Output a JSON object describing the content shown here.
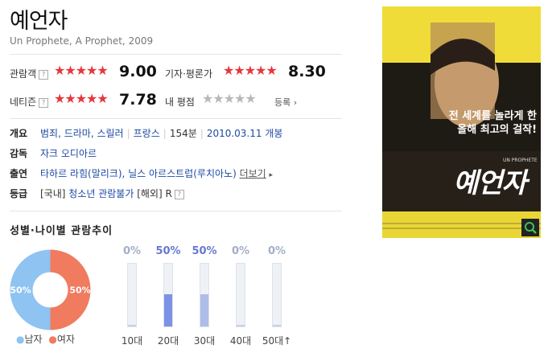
{
  "movie": {
    "title": "예언자",
    "subtitle": "Un Prophete, A Prophet, 2009"
  },
  "ratings": {
    "audience": {
      "label": "관람객",
      "help": "?",
      "stars": "★★★★★",
      "score": "9.00",
      "value": 9.0
    },
    "critics": {
      "label": "기자·평론가",
      "stars": "★★★★★",
      "score": "8.30",
      "value": 8.3
    },
    "netizen": {
      "label": "네티즌",
      "help": "?",
      "stars": "★★★★★",
      "score": "7.78",
      "value": 7.78
    },
    "my": {
      "label": "내 평점",
      "stars": "★★★★★",
      "register": "등록",
      "arrow": "›"
    }
  },
  "info": {
    "overview_key": "개요",
    "genres": "범죄, 드라마, 스릴러",
    "country": "프랑스",
    "runtime": "154분",
    "release": "2010.03.11 개봉",
    "director_key": "감독",
    "director": "자크 오디아르",
    "cast_key": "출연",
    "cast": "타하르 라힘(말리크), 닐스 아르스트럽(루치아노)",
    "more": "더보기",
    "more_arrow": "▸",
    "grade_key": "등급",
    "grade_prefix": "[국내]",
    "grade_domestic": "청소년 관람불가",
    "grade_foreign_prefix": "[해외]",
    "grade_foreign": "R",
    "grade_help": "?"
  },
  "chart_section": {
    "title": "성별·나이별 관람추이",
    "legend_male": "남자",
    "legend_female": "여자",
    "colors": {
      "male": "#8ec3f2",
      "female": "#f07b5e",
      "bar_strong": "#7b92e6",
      "bar_light": "#aebce8",
      "pct_zero": "#a3aec8",
      "pct_strong": "#6878d0"
    }
  },
  "chart_data": [
    {
      "type": "pie",
      "categories": [
        "남자",
        "여자"
      ],
      "values": [
        50,
        50
      ],
      "labels": [
        "50%",
        "50%"
      ]
    },
    {
      "type": "bar",
      "categories": [
        "10대",
        "20대",
        "30대",
        "40대",
        "50대↑"
      ],
      "values": [
        0,
        50,
        50,
        0,
        0
      ],
      "labels": [
        "0%",
        "50%",
        "50%",
        "0%",
        "0%"
      ],
      "ylim": [
        0,
        100
      ]
    }
  ],
  "poster": {
    "search_icon": "magnifier-icon",
    "title_text": "예언자",
    "headline": "전 세계를 놀라게 한 올해 최고의 걸작!",
    "brand": "UN PROPHETE"
  }
}
